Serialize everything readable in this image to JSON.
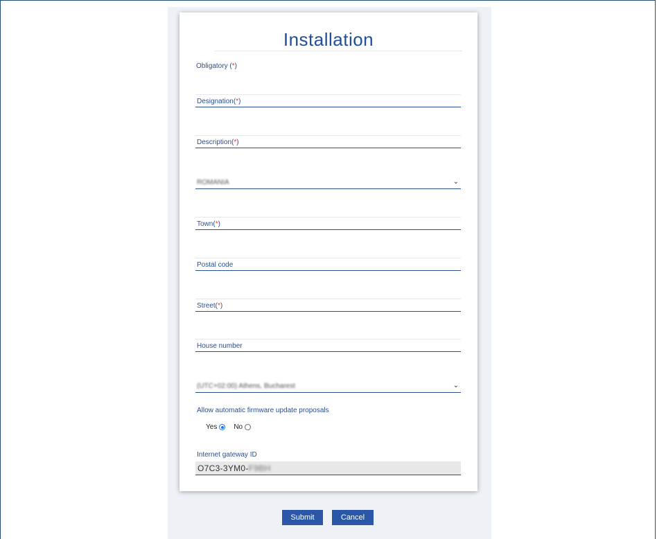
{
  "form": {
    "title": "Installation",
    "obligatory_note": "Obligatory (",
    "required_mark": "*",
    "note_close": ")",
    "fields": [
      {
        "label": "Designation(",
        "required": true
      },
      {
        "label": "Description(",
        "required": true
      },
      {
        "label": "Town(",
        "required": true
      },
      {
        "label": "Postal code",
        "required": false
      },
      {
        "label": "Street(",
        "required": true
      },
      {
        "label": "House number",
        "required": false
      }
    ],
    "country_select": {
      "value": "ROMANIA"
    },
    "timezone_select": {
      "value": "(UTC+02:00) Athens, Bucharest"
    },
    "firmware": {
      "label": "Allow automatic firmware update proposals",
      "yes_label": "Yes",
      "no_label": "No",
      "selected": "Yes"
    },
    "gateway": {
      "label": "Internet gateway ID",
      "value_visible": "O7C3-3YM0-",
      "value_hidden": "F9BH"
    }
  },
  "buttons": {
    "submit": "Submit",
    "cancel": "Cancel"
  },
  "colors": {
    "accent": "#2b57a8",
    "label": "#2a4f8f",
    "required": "#e53935",
    "panel_bg": "#eef2f7"
  }
}
